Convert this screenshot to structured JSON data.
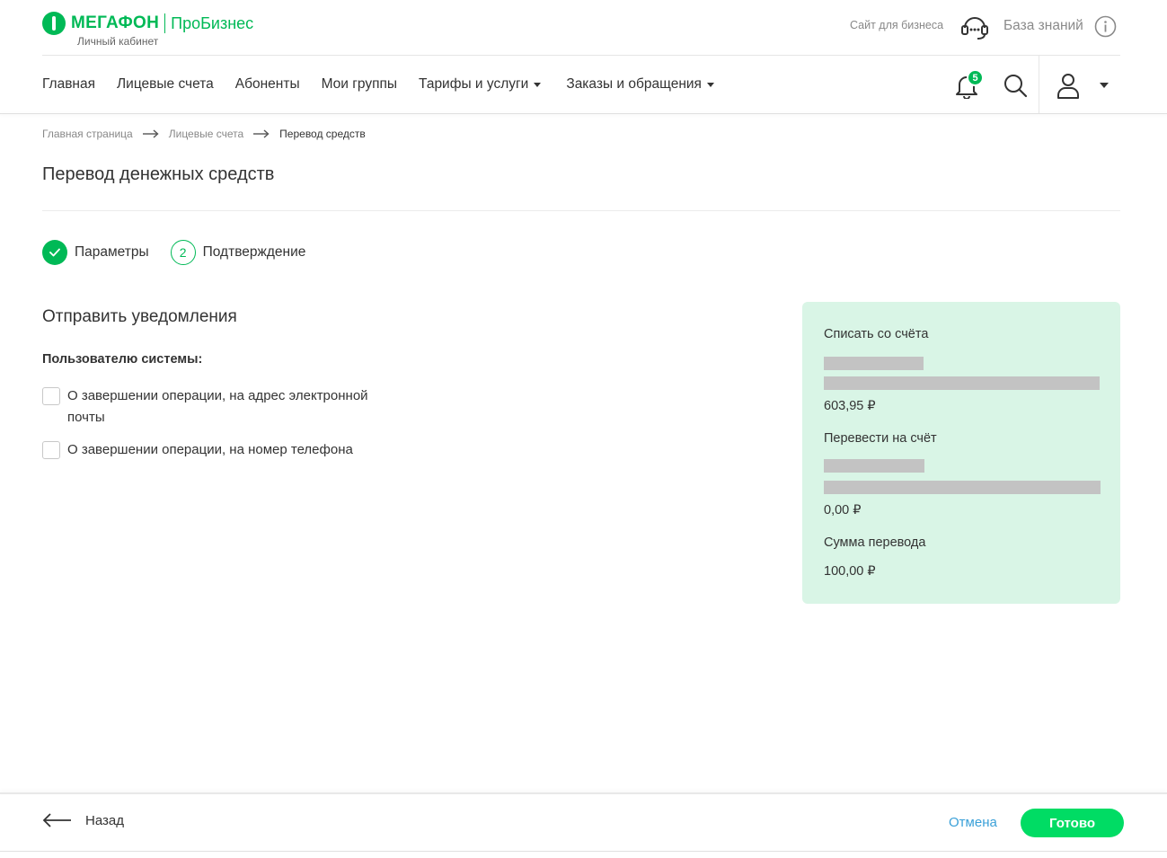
{
  "brand": {
    "logo_text": "МЕГАФОН",
    "logo_sub": "ПроБизнес",
    "cabinet": "Личный кабинет"
  },
  "header": {
    "business_site": "Сайт для бизнеса",
    "knowledge_base": "База знаний"
  },
  "nav": {
    "items": [
      {
        "label": "Главная"
      },
      {
        "label": "Лицевые счета"
      },
      {
        "label": "Абоненты"
      },
      {
        "label": "Мои группы"
      },
      {
        "label": "Тарифы и услуги"
      },
      {
        "label": "Заказы и обращения"
      }
    ],
    "notifications_count": "5",
    "icons": [
      "bell-icon",
      "search-icon",
      "user-icon",
      "chevron-down-icon"
    ]
  },
  "breadcrumb": [
    "Главная страница",
    "Лицевые счета",
    "Перевод средств"
  ],
  "page": {
    "title": "Перевод денежных средств"
  },
  "stepper": {
    "steps": [
      {
        "label": "Параметры",
        "state": "done"
      },
      {
        "label": "Подтверждение",
        "number": "2",
        "state": "current"
      }
    ]
  },
  "notifications": {
    "title": "Отправить уведомления",
    "subtitle": "Пользователю системы:",
    "options": [
      {
        "label": "О завершении операции, на адрес электронной почты",
        "checked": false
      },
      {
        "label": "О завершении операции, на номер телефона",
        "checked": false
      }
    ]
  },
  "summary": {
    "from_label": "Списать со счёта",
    "from_balance": "603,95 ₽",
    "to_label": "Перевести на счёт",
    "to_balance": "0,00 ₽",
    "amount_label": "Сумма перевода",
    "amount": "100,00 ₽"
  },
  "footer": {
    "back": "Назад",
    "cancel": "Отмена",
    "done": "Готово"
  },
  "colors": {
    "brand_green": "#00b956",
    "button_green": "#00dc64",
    "card_bg": "#d9f5e6",
    "link_blue": "#3aa0d8"
  }
}
